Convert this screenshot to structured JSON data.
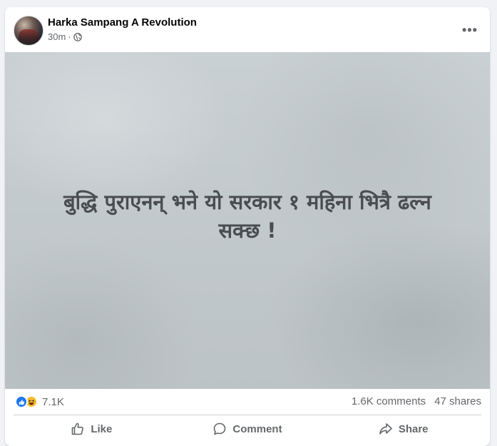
{
  "post": {
    "author": "Harka Sampang A Revolution",
    "time": "30m",
    "separator": "·",
    "privacy_icon": "globe-icon",
    "more_label": "•••",
    "image_text_line1": "बुद्धि पुराएनन् भने यो सरकार १ महिना भित्रै ढल्न",
    "image_text_line2": "सक्छ !"
  },
  "stats": {
    "reaction_icons": [
      "like-reaction-icon",
      "haha-reaction-icon"
    ],
    "reaction_count": "7.1K",
    "comments": "1.6K comments",
    "shares": "47 shares"
  },
  "actions": {
    "like_label": "Like",
    "comment_label": "Comment",
    "share_label": "Share"
  },
  "colors": {
    "background": "#f0f2f5",
    "card": "#ffffff",
    "secondary_text": "#65676b",
    "like_blue": "#1877f2",
    "haha_yellow": "#f7b928",
    "image_text": "#4a4d50"
  }
}
